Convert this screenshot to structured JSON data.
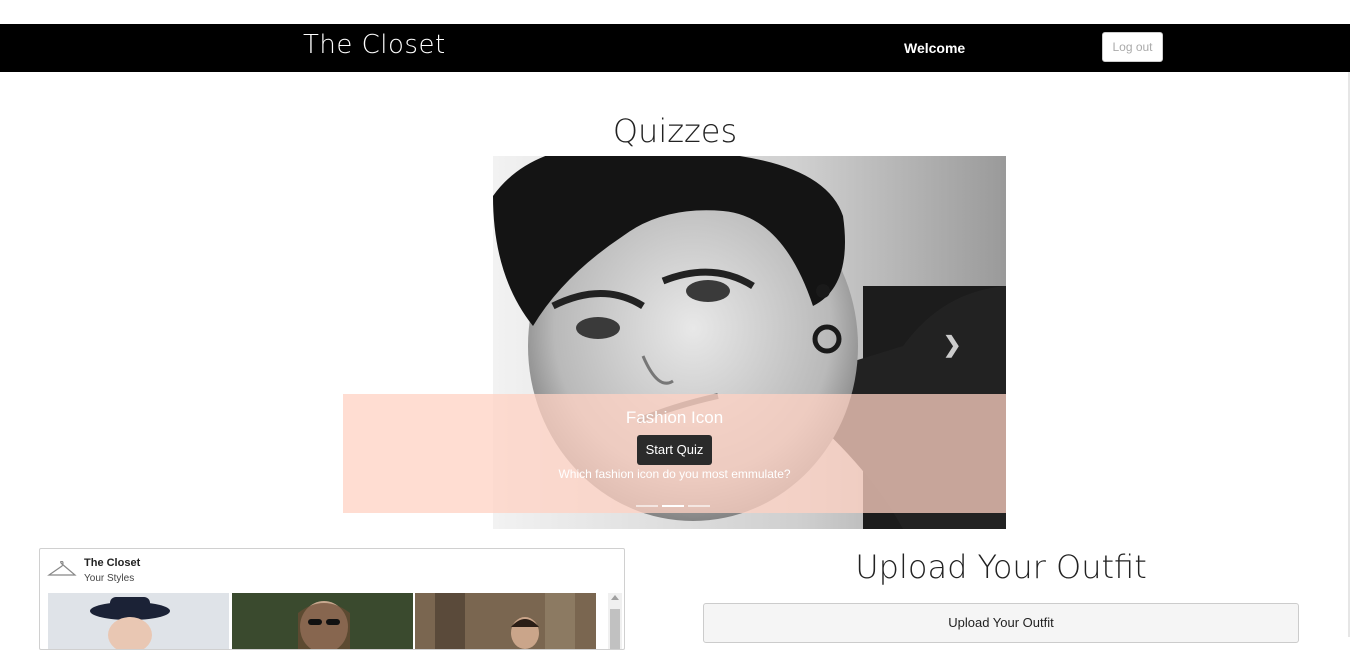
{
  "nav": {
    "brand": "The Closet",
    "welcome": "Welcome",
    "logout_label": "Log out"
  },
  "quizzes": {
    "heading": "Quizzes",
    "slide": {
      "title": "Fashion Icon",
      "button_label": "Start Quiz",
      "description": "Which fashion icon do you most emmulate?"
    },
    "indicator_count": 3,
    "active_indicator": 2
  },
  "widget": {
    "name": "The Closet",
    "subtitle": "Your Styles"
  },
  "upload": {
    "heading": "Upload Your Outfit",
    "button_label": "Upload Your Outfit"
  },
  "icons": {
    "next": "chevron-right-icon",
    "hanger": "hanger-icon"
  }
}
